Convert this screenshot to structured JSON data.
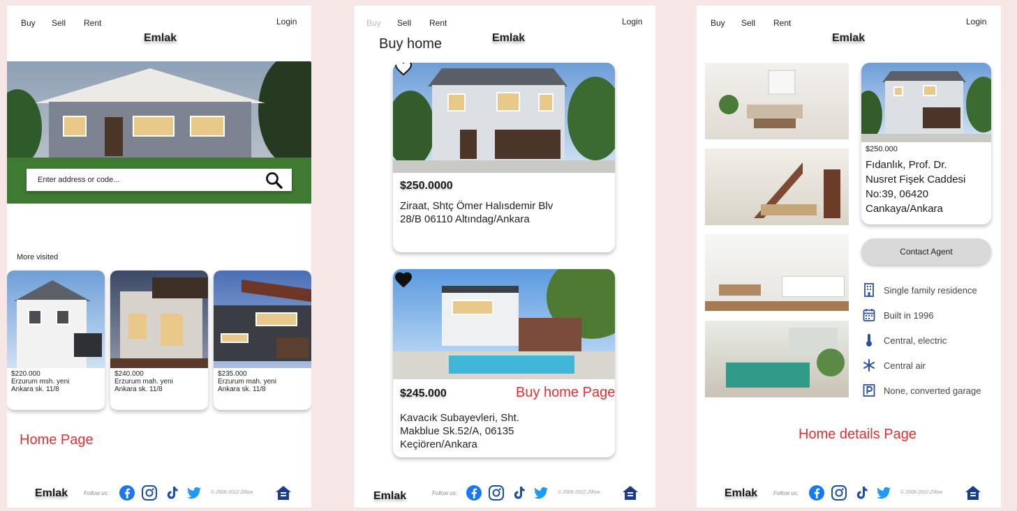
{
  "nav": {
    "buy": "Buy",
    "sell": "Sell",
    "rent": "Rent",
    "login": "Login",
    "brand": "Emlak"
  },
  "home": {
    "search_placeholder": "Enter address or code...",
    "more_visited": "More visited",
    "cards": [
      {
        "price": "$220.000",
        "line1": "Erzurum msh. yeni",
        "line2": "Ankara sk. 11/8"
      },
      {
        "price": "$240.000",
        "line1": "Erzurum mah. yeni",
        "line2": "Ankara sk. 11/8"
      },
      {
        "price": "$235.000",
        "line1": "Erzurum mah. yeni",
        "line2": "Ankara sk. 11/8"
      }
    ],
    "page_label": "Home Page"
  },
  "buy": {
    "title": "Buy home",
    "listings": [
      {
        "price": "$250.0000",
        "line1": "Ziraat, Shtç Ömer Halısdemir Blv",
        "line2": "28/B 06110 Altındag/Ankara",
        "line3": "",
        "favorited": false
      },
      {
        "price": "$245.000",
        "line1": "Kavacık Subayevleri, Sht.",
        "line2": "Makblue Sk.52/A, 06135",
        "line3": "Keçiören/Ankara",
        "favorited": true
      }
    ],
    "page_label": "Buy home Page"
  },
  "details": {
    "price": "$250.000",
    "address_lines": [
      "Fıdanlık, Prof. Dr.",
      "Nusret Fişek Caddesi",
      "No:39, 06420",
      "Cankaya/Ankara"
    ],
    "contact_label": "Contact Agent",
    "features": [
      {
        "icon": "building-icon",
        "text": "Single family residence"
      },
      {
        "icon": "calendar-icon",
        "text": "Built in 1996"
      },
      {
        "icon": "thermometer-icon",
        "text": "Central, electric"
      },
      {
        "icon": "snowflake-icon",
        "text": "Central air"
      },
      {
        "icon": "parking-icon",
        "text": "None, converted garage"
      }
    ],
    "page_label": "Home details Page"
  },
  "footer": {
    "brand": "Emlak",
    "follow": "Follow us:",
    "copyright": "© 2006-2022 Zillow",
    "social": [
      "facebook-icon",
      "instagram-icon",
      "tiktok-icon",
      "twitter-icon"
    ],
    "home_icon": "equal-housing-icon"
  },
  "colors": {
    "page_label": "#e0312e",
    "background": "#f6e6e6",
    "facebook": "#1877f2",
    "twitter": "#1d9bf0"
  }
}
